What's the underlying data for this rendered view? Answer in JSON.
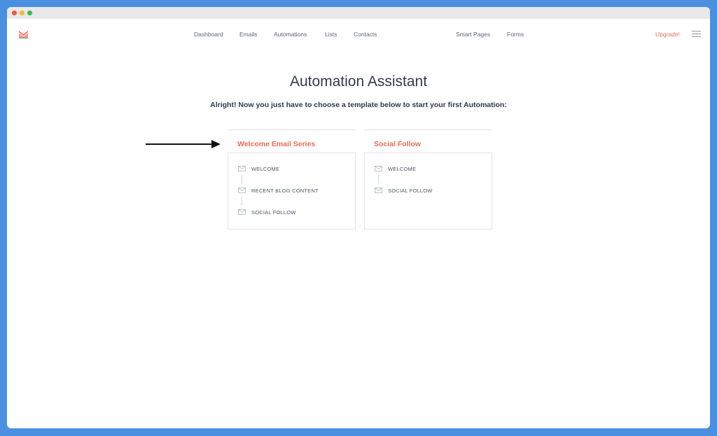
{
  "window": {
    "dots": [
      "#f2564c",
      "#f7b731",
      "#2fbf4b"
    ]
  },
  "nav": {
    "links": [
      "Dashboard",
      "Emails",
      "Automations",
      "Lists",
      "Contacts",
      "Smart Pages",
      "Forms"
    ],
    "upgrade": "Upgrade!",
    "logo_color": "#f26b4f",
    "accent": "#f26b4f"
  },
  "page": {
    "title": "Automation Assistant",
    "subtitle": "Alright! Now you just have to choose a template below to start your first Automation:"
  },
  "templates": [
    {
      "title": "Welcome Email Series",
      "steps": [
        "WELCOME",
        "RECENT BLOG CONTENT",
        "SOCIAL FOLLOW"
      ]
    },
    {
      "title": "Social Follow",
      "steps": [
        "WELCOME",
        "SOCIAL FOLLOW"
      ]
    }
  ]
}
